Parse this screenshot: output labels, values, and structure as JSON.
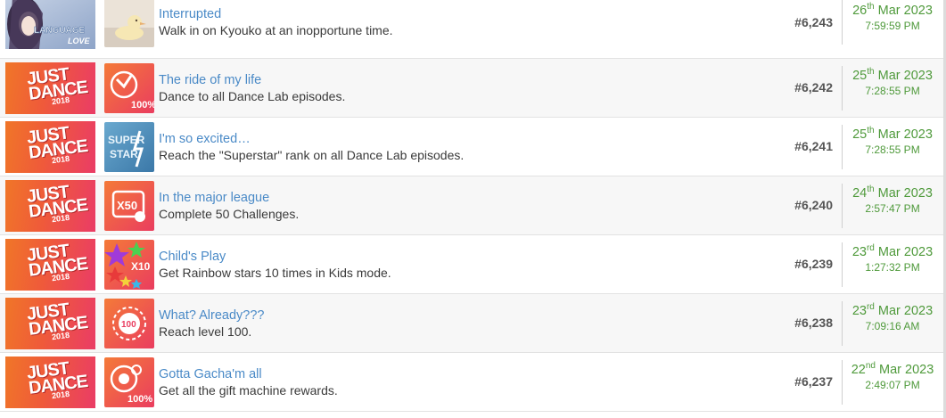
{
  "achievements": [
    {
      "title": "Interrupted",
      "description": "Walk in on Kyouko at an inopportune time.",
      "rank": "#6,243",
      "day": "26",
      "suffix": "th",
      "monthyear": "Mar 2023",
      "time": "7:59:59 PM",
      "game": "Language of Love",
      "game_label": "LANGUAGE",
      "game_label2": "LOVE",
      "icon": "rubber-duck-icon"
    },
    {
      "title": "The ride of my life",
      "description": "Dance to all Dance Lab episodes.",
      "rank": "#6,242",
      "day": "25",
      "suffix": "th",
      "monthyear": "Mar 2023",
      "time": "7:28:55 PM",
      "game": "Just Dance 2018",
      "icon": "100-percent-icon",
      "icon_text": "100%"
    },
    {
      "title": "I'm so excited…",
      "description": "Reach the \"Superstar\" rank on all Dance Lab episodes.",
      "rank": "#6,241",
      "day": "25",
      "suffix": "th",
      "monthyear": "Mar 2023",
      "time": "7:28:55 PM",
      "game": "Just Dance 2018",
      "icon": "superstar-icon",
      "icon_text": "SUPER STAR"
    },
    {
      "title": "In the major league",
      "description": "Complete 50 Challenges.",
      "rank": "#6,240",
      "day": "24",
      "suffix": "th",
      "monthyear": "Mar 2023",
      "time": "2:57:47 PM",
      "game": "Just Dance 2018",
      "icon": "x50-challenge-icon",
      "icon_text": "X50"
    },
    {
      "title": "Child's Play",
      "description": "Get Rainbow stars 10 times in Kids mode.",
      "rank": "#6,239",
      "day": "23",
      "suffix": "rd",
      "monthyear": "Mar 2023",
      "time": "1:27:32 PM",
      "game": "Just Dance 2018",
      "icon": "rainbow-stars-icon",
      "icon_text": "X10"
    },
    {
      "title": "What? Already???",
      "description": "Reach level 100.",
      "rank": "#6,238",
      "day": "23",
      "suffix": "rd",
      "monthyear": "Mar 2023",
      "time": "7:09:16 AM",
      "game": "Just Dance 2018",
      "icon": "level-100-badge-icon",
      "icon_text": "100"
    },
    {
      "title": "Gotta Gacha'm all",
      "description": "Get all the gift machine rewards.",
      "rank": "#6,237",
      "day": "22",
      "suffix": "nd",
      "monthyear": "Mar 2023",
      "time": "2:49:07 PM",
      "game": "Just Dance 2018",
      "icon": "gacha-100-percent-icon",
      "icon_text": "100%"
    }
  ],
  "just_dance_logo": {
    "line1": "JUST",
    "line2": "DANCE",
    "year": "2018"
  },
  "colors": {
    "link": "#4a8ac7",
    "date": "#4f9a3b",
    "rank": "#555555",
    "jd_orange": "#f07628",
    "jd_pink": "#ea3c66"
  }
}
